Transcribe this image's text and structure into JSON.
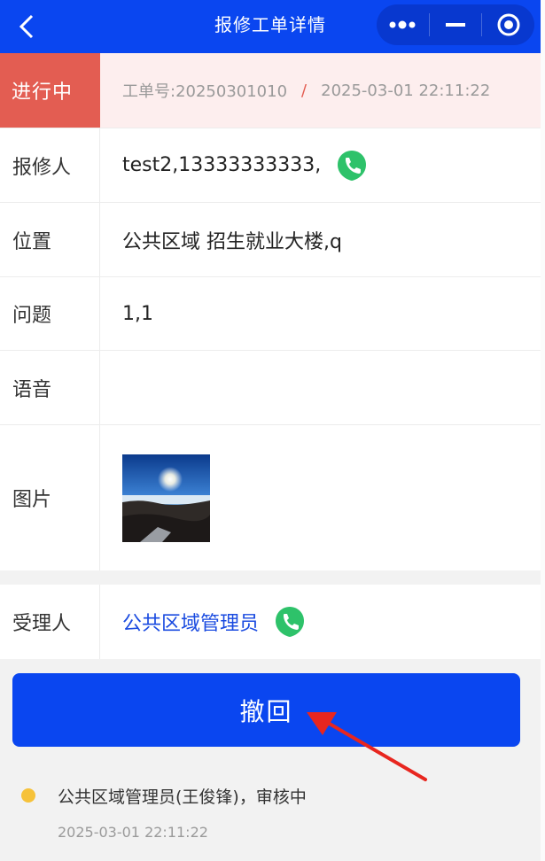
{
  "navbar": {
    "title": "报修工单详情",
    "back_icon": "chevron-left-icon",
    "menu_icons": [
      "more-dots-icon",
      "minimize-icon",
      "close-circle-icon"
    ]
  },
  "status": {
    "tag": "进行中",
    "order_no": "工单号:20250301010",
    "separator": "/",
    "datetime": "2025-03-01 22:11:22"
  },
  "details": {
    "reporter": {
      "label": "报修人",
      "value": "test2,13333333333,",
      "icon": "phone-icon"
    },
    "location": {
      "label": "位置",
      "value": "公共区域 招生就业大楼,q"
    },
    "problem": {
      "label": "问题",
      "value": "1,1"
    },
    "voice": {
      "label": "语音",
      "value": ""
    },
    "photo": {
      "label": "图片"
    },
    "handler": {
      "label": "受理人",
      "value": "公共区域管理员",
      "icon": "phone-icon"
    }
  },
  "action": {
    "recall_label": "撤回"
  },
  "timeline": [
    {
      "text": "公共区域管理员(王俊锋)，审核中",
      "time": "2025-03-01 22:11:22"
    }
  ],
  "colors": {
    "primary": "#0a46f0",
    "status_red": "#e35d52",
    "status_bg": "#fdeeee",
    "phone_green": "#2ec26a",
    "handler_blue": "#1a4be0",
    "timeline_dot": "#f6c23a"
  }
}
